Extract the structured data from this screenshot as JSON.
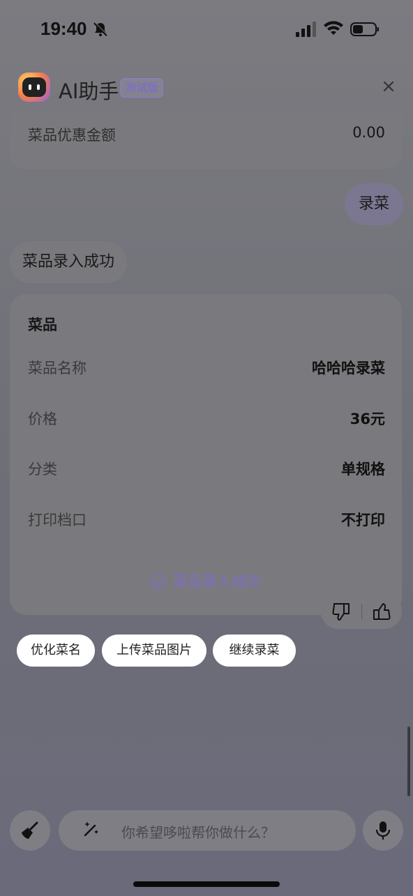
{
  "status_bar": {
    "time": "19:40"
  },
  "header": {
    "title": "AI助手",
    "badge": "测试版"
  },
  "previous_card": {
    "label": "菜品优惠金额",
    "value": "0.00"
  },
  "user_message": "录菜",
  "ai_message": "菜品录入成功",
  "dish_card": {
    "section_title": "菜品",
    "rows": [
      {
        "label": "菜品名称",
        "value": "哈哈哈录菜"
      },
      {
        "label": "价格",
        "value": "36元"
      },
      {
        "label": "分类",
        "value": "单规格"
      },
      {
        "label": "打印档口",
        "value": "不打印"
      }
    ],
    "success_text": "菜品录入成功"
  },
  "suggestions": [
    "优化菜名",
    "上传菜品图片",
    "继续录菜"
  ],
  "input": {
    "placeholder": "你希望哆啦帮你做什么？"
  },
  "colors": {
    "accent": "#7f6cc4",
    "overlay": "#7b7b80"
  }
}
